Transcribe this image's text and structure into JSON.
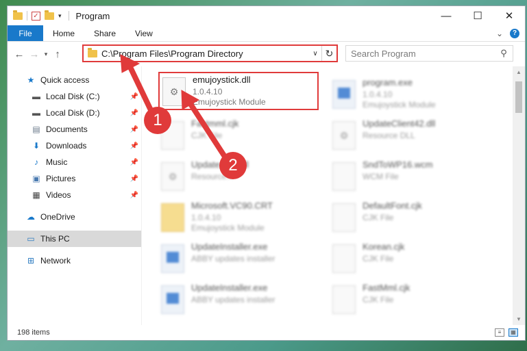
{
  "window": {
    "title": "Program",
    "controls": {
      "minimize": "—",
      "maximize": "☐",
      "close": "✕"
    }
  },
  "ribbon": {
    "file_tab": "File",
    "tabs": [
      "Home",
      "Share",
      "View"
    ],
    "help": "?"
  },
  "address": {
    "path": "C:\\Program Files\\Program Directory",
    "search_placeholder": "Search Program"
  },
  "sidebar": {
    "items": [
      {
        "label": "Quick access",
        "icon": "star-icon"
      },
      {
        "label": "Local Disk (C:)",
        "icon": "drive-icon",
        "pinned": true
      },
      {
        "label": "Local Disk (D:)",
        "icon": "drive-icon",
        "pinned": true
      },
      {
        "label": "Documents",
        "icon": "documents-icon",
        "pinned": true
      },
      {
        "label": "Downloads",
        "icon": "downloads-icon",
        "pinned": true
      },
      {
        "label": "Music",
        "icon": "music-icon",
        "pinned": true
      },
      {
        "label": "Pictures",
        "icon": "pictures-icon",
        "pinned": true
      },
      {
        "label": "Videos",
        "icon": "videos-icon",
        "pinned": true
      },
      {
        "label": "OneDrive",
        "icon": "onedrive-icon"
      },
      {
        "label": "This PC",
        "icon": "computer-icon",
        "selected": true
      },
      {
        "label": "Network",
        "icon": "network-icon"
      }
    ]
  },
  "files": [
    {
      "name": "emujoystick.dll",
      "line2": "1.0.4.10",
      "line3": "Emujoystick Module",
      "highlighted": true
    },
    {
      "name": "program.exe",
      "line2": "1.0.4.10",
      "line3": "Emujoystick Module"
    },
    {
      "name": "Fastmml.cjk",
      "line2": "CJK File",
      "line3": ""
    },
    {
      "name": "UpdateClient42.dll",
      "line2": "Resource DLL",
      "line3": ""
    },
    {
      "name": "Update...53.dll",
      "line2": "Resource...",
      "line3": ""
    },
    {
      "name": "SndToWP16.wcm",
      "line2": "WCM File",
      "line3": ""
    },
    {
      "name": "Microsoft.VC90.CRT",
      "line2": "1.0.4.10",
      "line3": "Emujoystick Module"
    },
    {
      "name": "DefaultFont.cjk",
      "line2": "CJK File",
      "line3": ""
    },
    {
      "name": "UpdateInstaller.exe",
      "line2": "ABBY updates installer",
      "line3": ""
    },
    {
      "name": "Korean.cjk",
      "line2": "CJK File",
      "line3": ""
    },
    {
      "name": "UpdateInstaller.exe",
      "line2": "ABBY updates installer",
      "line3": ""
    },
    {
      "name": "FastMml.cjk",
      "line2": "CJK File",
      "line3": ""
    }
  ],
  "callouts": [
    "1",
    "2"
  ],
  "status": {
    "count": "198 items"
  },
  "colors": {
    "accent": "#1979ca",
    "callout": "#e03a3a"
  }
}
